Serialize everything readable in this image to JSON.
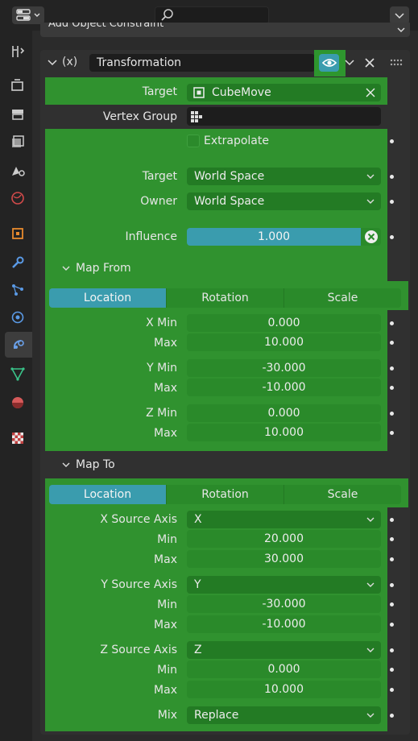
{
  "header_bar": {
    "add_constraint_label": "Add Object Constraint"
  },
  "constraint": {
    "expression_label": "(x)",
    "name": "Transformation",
    "target_label": "Target",
    "target_value": "CubeMove",
    "vertex_group_label": "Vertex Group",
    "vertex_group_value": "",
    "extrapolate_label": "Extrapolate",
    "space_target_label": "Target",
    "space_target_value": "World Space",
    "space_owner_label": "Owner",
    "space_owner_value": "World Space",
    "influence_label": "Influence",
    "influence_value": "1.000"
  },
  "map_from": {
    "title": "Map From",
    "tabs": [
      "Location",
      "Rotation",
      "Scale"
    ],
    "active_tab": "Location",
    "x_min_label": "X Min",
    "x_min": "0.000",
    "x_max_label": "Max",
    "x_max": "10.000",
    "y_min_label": "Y Min",
    "y_min": "-30.000",
    "y_max_label": "Max",
    "y_max": "-10.000",
    "z_min_label": "Z Min",
    "z_min": "0.000",
    "z_max_label": "Max",
    "z_max": "10.000"
  },
  "map_to": {
    "title": "Map To",
    "tabs": [
      "Location",
      "Rotation",
      "Scale"
    ],
    "active_tab": "Location",
    "x_source_label": "X Source Axis",
    "x_source": "X",
    "x_min_label": "Min",
    "x_min": "20.000",
    "x_max_label": "Max",
    "x_max": "30.000",
    "y_source_label": "Y Source Axis",
    "y_source": "Y",
    "y_min_label": "Min",
    "y_min": "-30.000",
    "y_max_label": "Max",
    "y_max": "-10.000",
    "z_source_label": "Z Source Axis",
    "z_source": "Z",
    "z_min_label": "Min",
    "z_min": "0.000",
    "z_max_label": "Max",
    "z_max": "10.000",
    "mix_label": "Mix",
    "mix": "Replace"
  },
  "colors": {
    "green_overlay": "#30922f",
    "active_blue": "#3a9cae",
    "panel_dark": "#1d1d1d"
  }
}
